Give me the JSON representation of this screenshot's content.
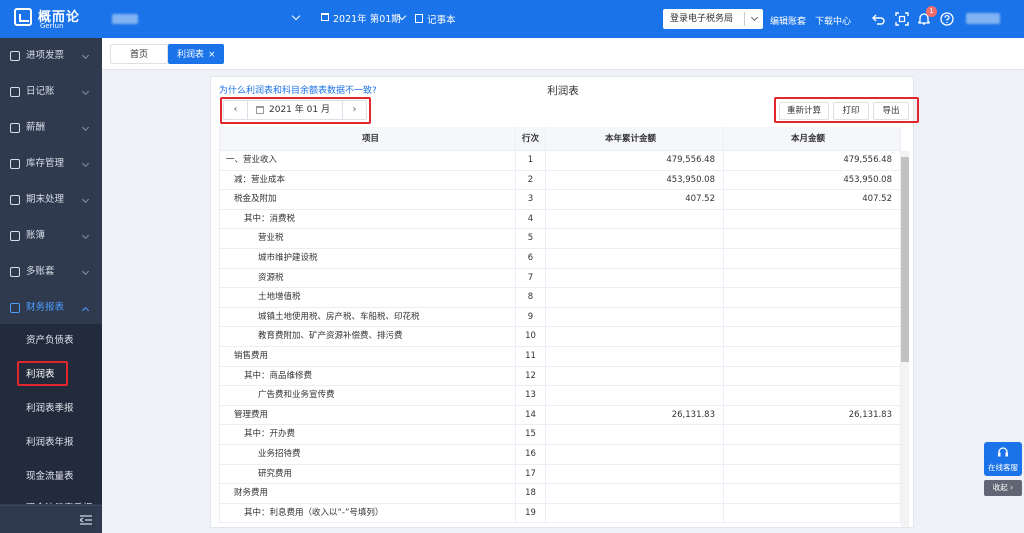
{
  "brand": {
    "name": "概而论",
    "sub": "Gerlun"
  },
  "header": {
    "period": "2021年 第01期",
    "notebook": "记事本",
    "tax_login": "登录电子税务局",
    "edit_account": "编辑账套",
    "download_center": "下载中心",
    "notification_count": "1"
  },
  "sidebar": {
    "items": [
      {
        "label": "进项发票",
        "icon": "invoice-icon"
      },
      {
        "label": "日记账",
        "icon": "journal-icon"
      },
      {
        "label": "薪酬",
        "icon": "salary-icon"
      },
      {
        "label": "库存管理",
        "icon": "warehouse-icon"
      },
      {
        "label": "期末处理",
        "icon": "period-end-icon"
      },
      {
        "label": "账簿",
        "icon": "ledger-icon"
      },
      {
        "label": "多账套",
        "icon": "multi-account-icon"
      },
      {
        "label": "财务报表",
        "icon": "report-icon"
      }
    ],
    "submenu": [
      "资产负债表",
      "利润表",
      "利润表季报",
      "利润表年报",
      "现金流量表",
      "现金流量表季报"
    ]
  },
  "tabs": {
    "home": "首页",
    "active": "利润表",
    "close": "×"
  },
  "report": {
    "help_link": "为什么利润表和科目余额表数据不一致?",
    "title": "利润表",
    "date": "2021 年 01 月",
    "prev": "‹",
    "next": "›",
    "buttons": {
      "recalc": "重新计算",
      "print": "打印",
      "export": "导出"
    },
    "columns": [
      "项目",
      "行次",
      "本年累计金额",
      "本月金额"
    ],
    "rows": [
      {
        "item": "一、营业收入",
        "line": "1",
        "ytd": "479,556.48",
        "month": "479,556.48",
        "indent": 0
      },
      {
        "item": "减：营业成本",
        "line": "2",
        "ytd": "453,950.08",
        "month": "453,950.08",
        "indent": 1
      },
      {
        "item": "税金及附加",
        "line": "3",
        "ytd": "407.52",
        "month": "407.52",
        "indent": 1
      },
      {
        "item": "其中：消费税",
        "line": "4",
        "ytd": "",
        "month": "",
        "indent": 2
      },
      {
        "item": "营业税",
        "line": "5",
        "ytd": "",
        "month": "",
        "indent": 3
      },
      {
        "item": "城市维护建设税",
        "line": "6",
        "ytd": "",
        "month": "",
        "indent": 3
      },
      {
        "item": "资源税",
        "line": "7",
        "ytd": "",
        "month": "",
        "indent": 3
      },
      {
        "item": "土地增值税",
        "line": "8",
        "ytd": "",
        "month": "",
        "indent": 3
      },
      {
        "item": "城镇土地使用税、房产税、车船税、印花税",
        "line": "9",
        "ytd": "",
        "month": "",
        "indent": 3
      },
      {
        "item": "教育费附加、矿产资源补偿费、排污费",
        "line": "10",
        "ytd": "",
        "month": "",
        "indent": 3
      },
      {
        "item": "销售费用",
        "line": "11",
        "ytd": "",
        "month": "",
        "indent": 1
      },
      {
        "item": "其中：商品维修费",
        "line": "12",
        "ytd": "",
        "month": "",
        "indent": 2
      },
      {
        "item": "广告费和业务宣传费",
        "line": "13",
        "ytd": "",
        "month": "",
        "indent": 3
      },
      {
        "item": "管理费用",
        "line": "14",
        "ytd": "26,131.83",
        "month": "26,131.83",
        "indent": 1
      },
      {
        "item": "其中：开办费",
        "line": "15",
        "ytd": "",
        "month": "",
        "indent": 2
      },
      {
        "item": "业务招待费",
        "line": "16",
        "ytd": "",
        "month": "",
        "indent": 3
      },
      {
        "item": "研究费用",
        "line": "17",
        "ytd": "",
        "month": "",
        "indent": 3
      },
      {
        "item": "财务费用",
        "line": "18",
        "ytd": "",
        "month": "",
        "indent": 1
      },
      {
        "item": "其中：利息费用（收入以“-”号填列）",
        "line": "19",
        "ytd": "",
        "month": "",
        "indent": 2
      }
    ]
  },
  "float": {
    "service": "在线客服",
    "collapse": "收起 ›"
  },
  "colors": {
    "primary": "#1a73e8",
    "sidebar": "#2f3a4f",
    "highlight": "#e3262e"
  }
}
